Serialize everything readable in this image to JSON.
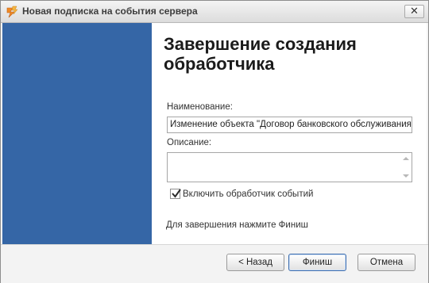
{
  "window": {
    "title": "Новая подписка на события сервера",
    "close_label": "✕"
  },
  "main": {
    "heading_line1": "Завершение создания",
    "heading_line2": "обработчика",
    "name_label": "Наименование:",
    "name_value": "Изменение объекта \"Договор банковского обслуживания\"",
    "description_label": "Описание:",
    "description_value": "",
    "enable_checkbox_label": "Включить обработчик событий",
    "enable_checked": true,
    "finish_hint": "Для завершения нажмите Финиш"
  },
  "buttons": {
    "back": "< Назад",
    "finish": "Финиш",
    "cancel": "Отмена"
  },
  "colors": {
    "side_panel": "#3566a6",
    "default_button_border": "#3d6dae"
  },
  "icons": {
    "title_icon": "lightning-app-icon",
    "close": "close-icon",
    "check": "checkmark-icon"
  }
}
